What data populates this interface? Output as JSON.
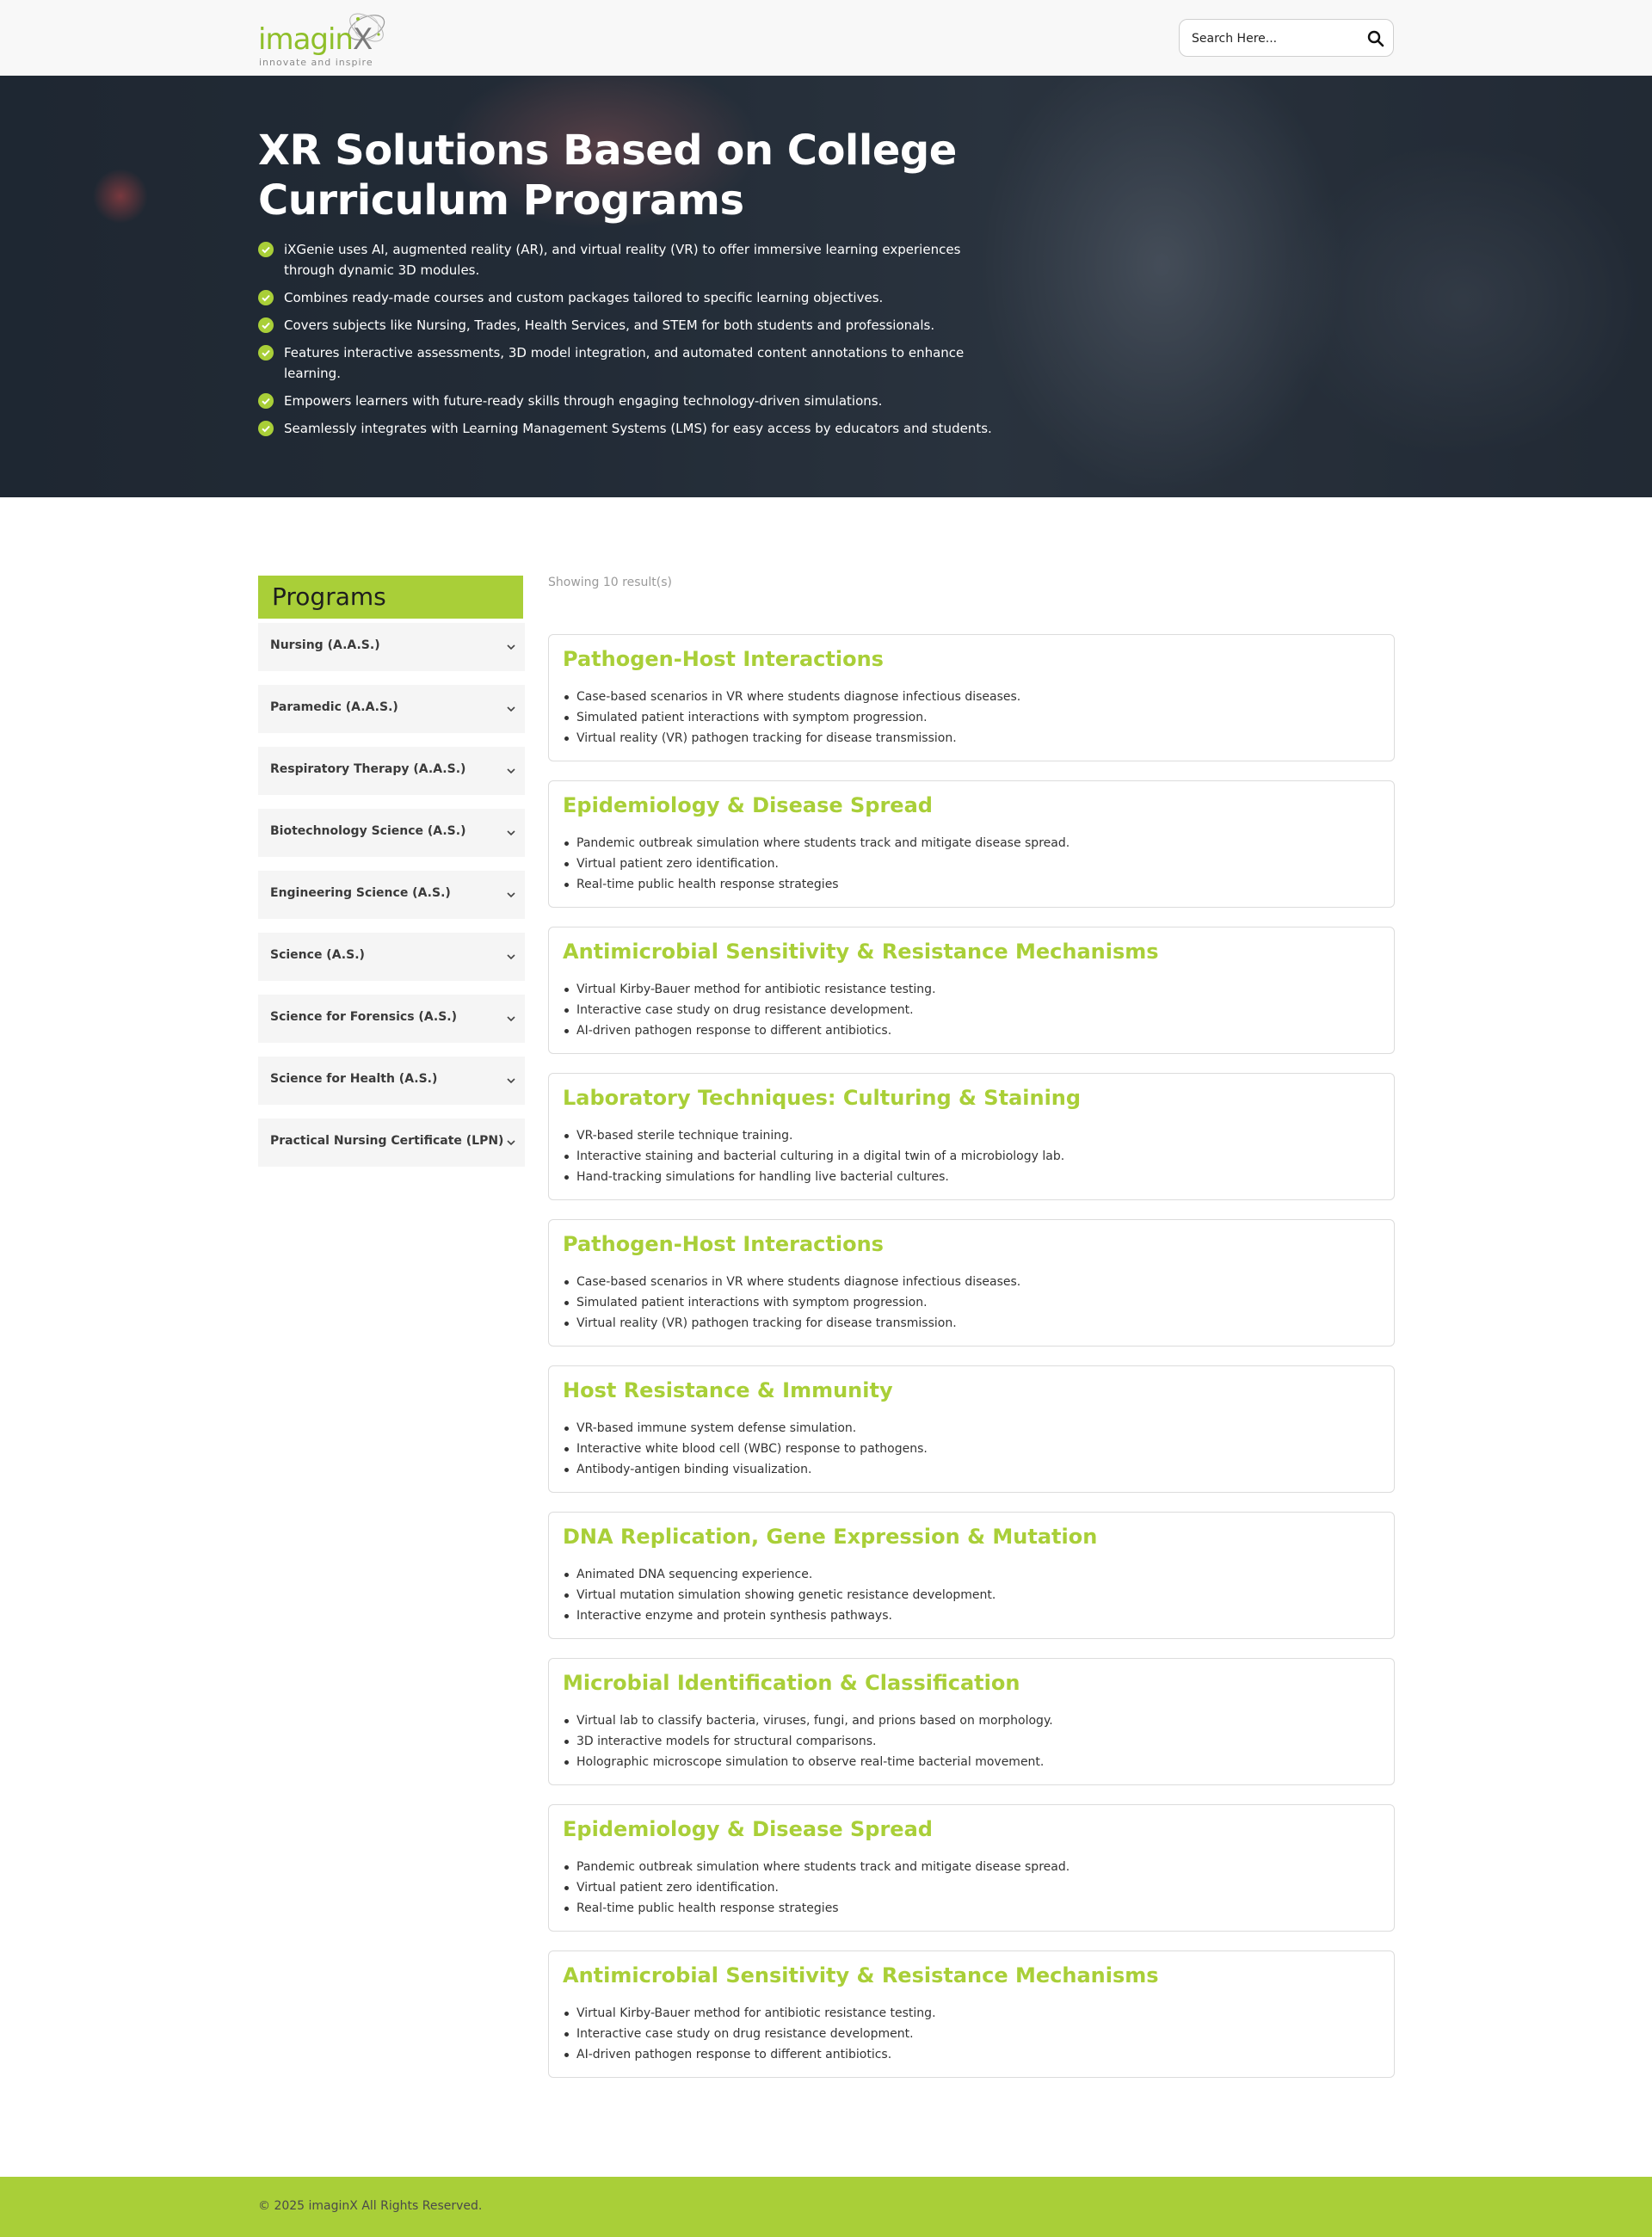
{
  "brand": {
    "name_main": "imagin",
    "name_x": "X",
    "tagline": "innovate and inspire",
    "accent_color": "#a9cf38"
  },
  "search": {
    "placeholder": "Search Here...",
    "icon": "search-icon"
  },
  "hero": {
    "title_line1": "XR Solutions Based on College",
    "title_line2": "Curriculum Programs",
    "points": [
      "iXGenie uses AI, augmented reality (AR), and virtual reality (VR) to offer immersive learning experiences through dynamic 3D modules.",
      "Combines ready-made courses and custom packages tailored to specific learning objectives.",
      "Covers subjects like Nursing, Trades, Health Services, and STEM for both students and professionals.",
      "Features interactive assessments, 3D model integration, and automated content annotations to enhance learning.",
      "Empowers learners with future-ready skills through engaging technology-driven simulations.",
      "Seamlessly integrates with Learning Management Systems (LMS) for easy access by educators and students."
    ]
  },
  "sidebar": {
    "title": "Programs",
    "items": [
      "Nursing (A.A.S.)",
      "Paramedic (A.A.S.)",
      "Respiratory Therapy (A.A.S.)",
      "Biotechnology Science (A.S.)",
      "Engineering Science (A.S.)",
      "Science (A.S.)",
      "Science for Forensics (A.S.)",
      "Science for Health (A.S.)",
      "Practical Nursing Certificate (LPN)"
    ]
  },
  "results": {
    "summary": "Showing 10 result(s)",
    "cards": [
      {
        "title": "Pathogen-Host Interactions",
        "points": [
          "Case-based scenarios in VR where students diagnose infectious diseases.",
          "Simulated patient interactions with symptom progression.",
          "Virtual reality (VR) pathogen tracking for disease transmission."
        ]
      },
      {
        "title": "Epidemiology & Disease Spread",
        "points": [
          "Pandemic outbreak simulation where students track and mitigate disease spread.",
          "Virtual patient zero identification.",
          "Real-time public health response strategies"
        ]
      },
      {
        "title": "Antimicrobial Sensitivity & Resistance Mechanisms",
        "points": [
          "Virtual Kirby-Bauer method for antibiotic resistance testing.",
          "Interactive case study on drug resistance development.",
          "AI-driven pathogen response to different antibiotics."
        ]
      },
      {
        "title": "Laboratory Techniques: Culturing & Staining",
        "points": [
          "VR-based sterile technique training.",
          "Interactive staining and bacterial culturing in a digital twin of a microbiology lab.",
          "Hand-tracking simulations for handling live bacterial cultures."
        ]
      },
      {
        "title": "Pathogen-Host Interactions",
        "points": [
          "Case-based scenarios in VR where students diagnose infectious diseases.",
          "Simulated patient interactions with symptom progression.",
          "Virtual reality (VR) pathogen tracking for disease transmission."
        ]
      },
      {
        "title": "Host Resistance & Immunity",
        "points": [
          "VR-based immune system defense simulation.",
          "Interactive white blood cell (WBC) response to pathogens.",
          "Antibody-antigen binding visualization."
        ]
      },
      {
        "title": "DNA Replication, Gene Expression & Mutation",
        "points": [
          "Animated DNA sequencing experience.",
          "Virtual mutation simulation showing genetic resistance development.",
          "Interactive enzyme and protein synthesis pathways."
        ]
      },
      {
        "title": "Microbial Identification & Classification",
        "points": [
          "Virtual lab to classify bacteria, viruses, fungi, and prions based on morphology.",
          "3D interactive models for structural comparisons.",
          "Holographic microscope simulation to observe real-time bacterial movement."
        ]
      },
      {
        "title": "Epidemiology & Disease Spread",
        "points": [
          "Pandemic outbreak simulation where students track and mitigate disease spread.",
          "Virtual patient zero identification.",
          "Real-time public health response strategies"
        ]
      },
      {
        "title": "Antimicrobial Sensitivity & Resistance Mechanisms",
        "points": [
          "Virtual Kirby-Bauer method for antibiotic resistance testing.",
          "Interactive case study on drug resistance development.",
          "AI-driven pathogen response to different antibiotics."
        ]
      }
    ]
  },
  "footer": {
    "copyright": "© 2025 imaginX All Rights Reserved."
  }
}
